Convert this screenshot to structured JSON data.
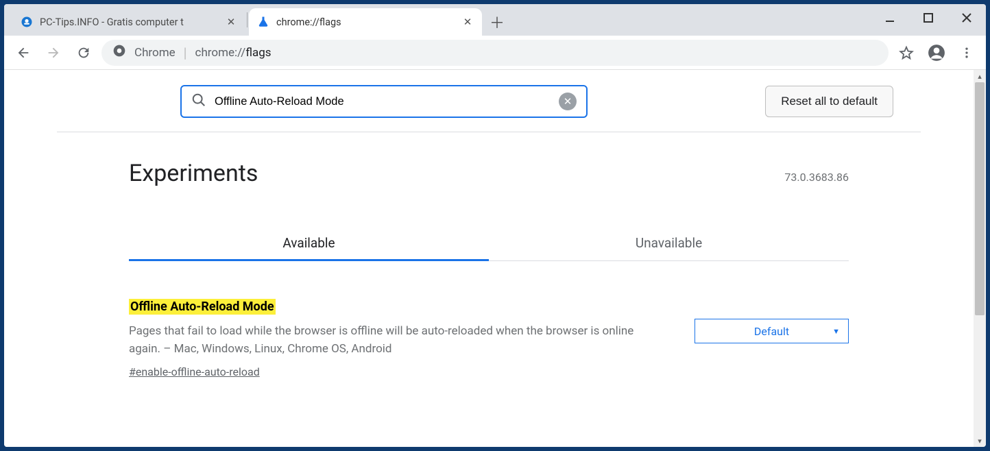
{
  "window": {
    "tabs": [
      {
        "title": "PC-Tips.INFO - Gratis computer t",
        "active": false
      },
      {
        "title": "chrome://flags",
        "active": true
      }
    ]
  },
  "omnibox": {
    "scheme_label": "Chrome",
    "url_host": "chrome://",
    "url_path": "flags"
  },
  "flags": {
    "search_value": "Offline Auto-Reload Mode",
    "reset_label": "Reset all to default",
    "experiments_title": "Experiments",
    "version": "73.0.3683.86",
    "tabs": [
      {
        "label": "Available",
        "active": true
      },
      {
        "label": "Unavailable",
        "active": false
      }
    ],
    "item": {
      "title": "Offline Auto-Reload Mode",
      "description": "Pages that fail to load while the browser is offline will be auto-reloaded when the browser is online again. – Mac, Windows, Linux, Chrome OS, Android",
      "anchor": "#enable-offline-auto-reload",
      "select_value": "Default"
    }
  }
}
